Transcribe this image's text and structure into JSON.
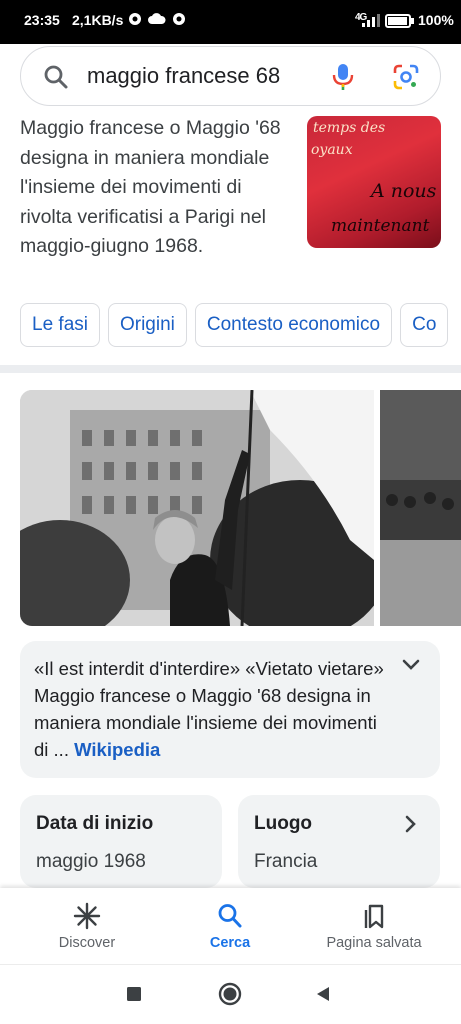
{
  "status_bar": {
    "time": "23:35",
    "speed": "2,1KB/s",
    "network": "4G",
    "battery": "100%"
  },
  "search": {
    "query": "maggio francese 68"
  },
  "description": {
    "text": "Maggio francese o Maggio '68 designa in maniera mondiale l'insieme dei movimenti di rivolta verificatisi a Parigi nel maggio-giugno 1968.",
    "thumbnail_text": [
      "temps des",
      "oyaux",
      "A nous",
      "maintenant"
    ]
  },
  "chips": [
    "Le fasi",
    "Origini",
    "Contesto economico",
    "Co"
  ],
  "wiki_card": {
    "text": "«Il est interdit d'interdire» «Vietato vietare» Maggio francese o Maggio '68 designa in maniera mondiale l'insieme dei movimenti di ...",
    "source": "Wikipedia"
  },
  "facts": [
    {
      "label": "Data di inizio",
      "value": "maggio 1968"
    },
    {
      "label": "Luogo",
      "value": "Francia"
    }
  ],
  "bottom_nav": {
    "items": [
      {
        "label": "Discover",
        "icon": "asterisk-icon",
        "active": false
      },
      {
        "label": "Cerca",
        "icon": "search-icon",
        "active": true
      },
      {
        "label": "Pagina salvata",
        "icon": "bookmark-icon",
        "active": false
      }
    ]
  },
  "system_nav": [
    "square-icon",
    "circle-icon",
    "back-triangle-icon"
  ],
  "colors": {
    "link": "#1a5fc4",
    "active": "#1a73e8",
    "card_bg": "#f1f3f4"
  }
}
